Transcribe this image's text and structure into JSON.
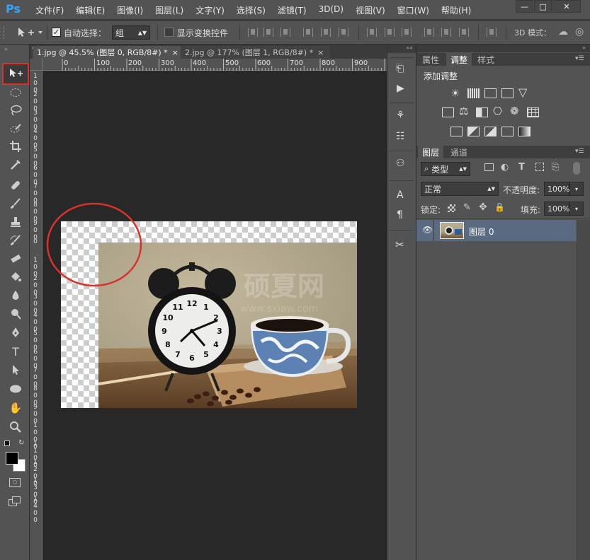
{
  "app": {
    "logo": "Ps"
  },
  "menu": [
    "文件(F)",
    "编辑(E)",
    "图像(I)",
    "图层(L)",
    "文字(Y)",
    "选择(S)",
    "滤镜(T)",
    "3D(D)",
    "视图(V)",
    "窗口(W)",
    "帮助(H)"
  ],
  "window_controls": {
    "minimize": "—",
    "maximize": "□",
    "close": "✕"
  },
  "options": {
    "auto_select_label": "自动选择：",
    "auto_select_checked": "✓",
    "auto_select_value": "组",
    "show_transform_label": "显示变换控件",
    "mode_label": "3D 模式："
  },
  "tabs": [
    {
      "label": "1.jpg @ 45.5% (图层 0, RGB/8#) *",
      "close": "×"
    },
    {
      "label": "2.jpg @ 177% (图层 1, RGB/8#) *",
      "close": "×"
    }
  ],
  "ruler_top": [
    "0",
    "100",
    "200",
    "300",
    "400",
    "500",
    "600",
    "700",
    "800",
    "900"
  ],
  "ruler_left": [
    [
      "1",
      "0",
      "0"
    ],
    [
      "2",
      "0",
      "0"
    ],
    [
      "3",
      "0",
      "0"
    ],
    [
      "4",
      "0",
      "0"
    ],
    [
      "5",
      "0",
      "0"
    ],
    [
      "6",
      "0",
      "0"
    ],
    [
      "7",
      "0",
      "0"
    ],
    [
      "8",
      "0",
      "0"
    ],
    [
      "9",
      "0",
      "0"
    ],
    [
      "0"
    ],
    [
      "1",
      "0",
      "0"
    ],
    [
      "2",
      "0",
      "0"
    ],
    [
      "3",
      "0",
      "0"
    ],
    [
      "4",
      "0",
      "0"
    ],
    [
      "5",
      "0",
      "0"
    ],
    [
      "6",
      "0",
      "0"
    ],
    [
      "7",
      "0",
      "0"
    ],
    [
      "8",
      "0",
      "0"
    ],
    [
      "9",
      "0",
      "0"
    ],
    [
      "1",
      "0",
      "0",
      "0"
    ],
    [
      "1",
      "1",
      "0",
      "0"
    ],
    [
      "1",
      "2",
      "0",
      "0"
    ],
    [
      "1",
      "3",
      "0",
      "0"
    ],
    [
      "1",
      "4",
      "0",
      "0"
    ]
  ],
  "image": {
    "watermark_main": "硕夏网",
    "watermark_sub": "www.sxiaw.com",
    "clock_numbers": [
      "12",
      "1",
      "2",
      "3",
      "4",
      "5",
      "6",
      "7",
      "8",
      "9",
      "10",
      "11"
    ]
  },
  "panels": {
    "top_tabs": [
      "属性",
      "调整",
      "样式"
    ],
    "adjust_title": "添加调整",
    "layer_tabs": [
      "图层",
      "通道"
    ],
    "filter_kind": "类型",
    "blend_mode": "正常",
    "opacity_label": "不透明度:",
    "opacity_value": "100%",
    "lock_label": "锁定:",
    "fill_label": "填充:",
    "fill_value": "100%",
    "layer_name": "图层 0"
  },
  "colors": {
    "accent": "#31a8ff",
    "highlight": "#d8332a",
    "selected_layer": "#5a6a81"
  }
}
